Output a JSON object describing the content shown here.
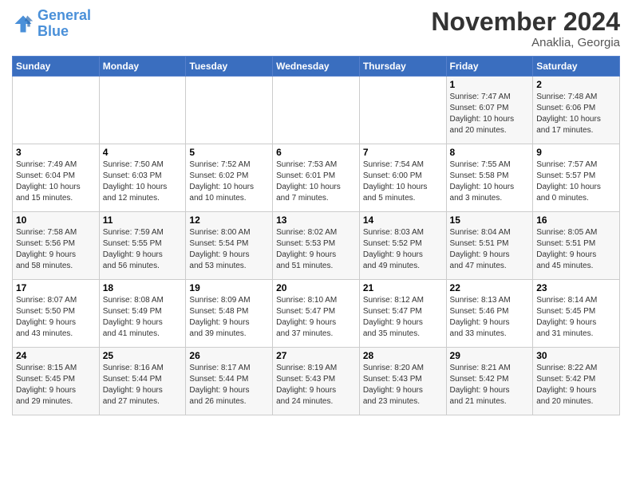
{
  "header": {
    "logo_line1": "General",
    "logo_line2": "Blue",
    "month": "November 2024",
    "location": "Anaklia, Georgia"
  },
  "weekdays": [
    "Sunday",
    "Monday",
    "Tuesday",
    "Wednesday",
    "Thursday",
    "Friday",
    "Saturday"
  ],
  "weeks": [
    [
      {
        "day": "",
        "info": ""
      },
      {
        "day": "",
        "info": ""
      },
      {
        "day": "",
        "info": ""
      },
      {
        "day": "",
        "info": ""
      },
      {
        "day": "",
        "info": ""
      },
      {
        "day": "1",
        "info": "Sunrise: 7:47 AM\nSunset: 6:07 PM\nDaylight: 10 hours\nand 20 minutes."
      },
      {
        "day": "2",
        "info": "Sunrise: 7:48 AM\nSunset: 6:06 PM\nDaylight: 10 hours\nand 17 minutes."
      }
    ],
    [
      {
        "day": "3",
        "info": "Sunrise: 7:49 AM\nSunset: 6:04 PM\nDaylight: 10 hours\nand 15 minutes."
      },
      {
        "day": "4",
        "info": "Sunrise: 7:50 AM\nSunset: 6:03 PM\nDaylight: 10 hours\nand 12 minutes."
      },
      {
        "day": "5",
        "info": "Sunrise: 7:52 AM\nSunset: 6:02 PM\nDaylight: 10 hours\nand 10 minutes."
      },
      {
        "day": "6",
        "info": "Sunrise: 7:53 AM\nSunset: 6:01 PM\nDaylight: 10 hours\nand 7 minutes."
      },
      {
        "day": "7",
        "info": "Sunrise: 7:54 AM\nSunset: 6:00 PM\nDaylight: 10 hours\nand 5 minutes."
      },
      {
        "day": "8",
        "info": "Sunrise: 7:55 AM\nSunset: 5:58 PM\nDaylight: 10 hours\nand 3 minutes."
      },
      {
        "day": "9",
        "info": "Sunrise: 7:57 AM\nSunset: 5:57 PM\nDaylight: 10 hours\nand 0 minutes."
      }
    ],
    [
      {
        "day": "10",
        "info": "Sunrise: 7:58 AM\nSunset: 5:56 PM\nDaylight: 9 hours\nand 58 minutes."
      },
      {
        "day": "11",
        "info": "Sunrise: 7:59 AM\nSunset: 5:55 PM\nDaylight: 9 hours\nand 56 minutes."
      },
      {
        "day": "12",
        "info": "Sunrise: 8:00 AM\nSunset: 5:54 PM\nDaylight: 9 hours\nand 53 minutes."
      },
      {
        "day": "13",
        "info": "Sunrise: 8:02 AM\nSunset: 5:53 PM\nDaylight: 9 hours\nand 51 minutes."
      },
      {
        "day": "14",
        "info": "Sunrise: 8:03 AM\nSunset: 5:52 PM\nDaylight: 9 hours\nand 49 minutes."
      },
      {
        "day": "15",
        "info": "Sunrise: 8:04 AM\nSunset: 5:51 PM\nDaylight: 9 hours\nand 47 minutes."
      },
      {
        "day": "16",
        "info": "Sunrise: 8:05 AM\nSunset: 5:51 PM\nDaylight: 9 hours\nand 45 minutes."
      }
    ],
    [
      {
        "day": "17",
        "info": "Sunrise: 8:07 AM\nSunset: 5:50 PM\nDaylight: 9 hours\nand 43 minutes."
      },
      {
        "day": "18",
        "info": "Sunrise: 8:08 AM\nSunset: 5:49 PM\nDaylight: 9 hours\nand 41 minutes."
      },
      {
        "day": "19",
        "info": "Sunrise: 8:09 AM\nSunset: 5:48 PM\nDaylight: 9 hours\nand 39 minutes."
      },
      {
        "day": "20",
        "info": "Sunrise: 8:10 AM\nSunset: 5:47 PM\nDaylight: 9 hours\nand 37 minutes."
      },
      {
        "day": "21",
        "info": "Sunrise: 8:12 AM\nSunset: 5:47 PM\nDaylight: 9 hours\nand 35 minutes."
      },
      {
        "day": "22",
        "info": "Sunrise: 8:13 AM\nSunset: 5:46 PM\nDaylight: 9 hours\nand 33 minutes."
      },
      {
        "day": "23",
        "info": "Sunrise: 8:14 AM\nSunset: 5:45 PM\nDaylight: 9 hours\nand 31 minutes."
      }
    ],
    [
      {
        "day": "24",
        "info": "Sunrise: 8:15 AM\nSunset: 5:45 PM\nDaylight: 9 hours\nand 29 minutes."
      },
      {
        "day": "25",
        "info": "Sunrise: 8:16 AM\nSunset: 5:44 PM\nDaylight: 9 hours\nand 27 minutes."
      },
      {
        "day": "26",
        "info": "Sunrise: 8:17 AM\nSunset: 5:44 PM\nDaylight: 9 hours\nand 26 minutes."
      },
      {
        "day": "27",
        "info": "Sunrise: 8:19 AM\nSunset: 5:43 PM\nDaylight: 9 hours\nand 24 minutes."
      },
      {
        "day": "28",
        "info": "Sunrise: 8:20 AM\nSunset: 5:43 PM\nDaylight: 9 hours\nand 23 minutes."
      },
      {
        "day": "29",
        "info": "Sunrise: 8:21 AM\nSunset: 5:42 PM\nDaylight: 9 hours\nand 21 minutes."
      },
      {
        "day": "30",
        "info": "Sunrise: 8:22 AM\nSunset: 5:42 PM\nDaylight: 9 hours\nand 20 minutes."
      }
    ]
  ]
}
